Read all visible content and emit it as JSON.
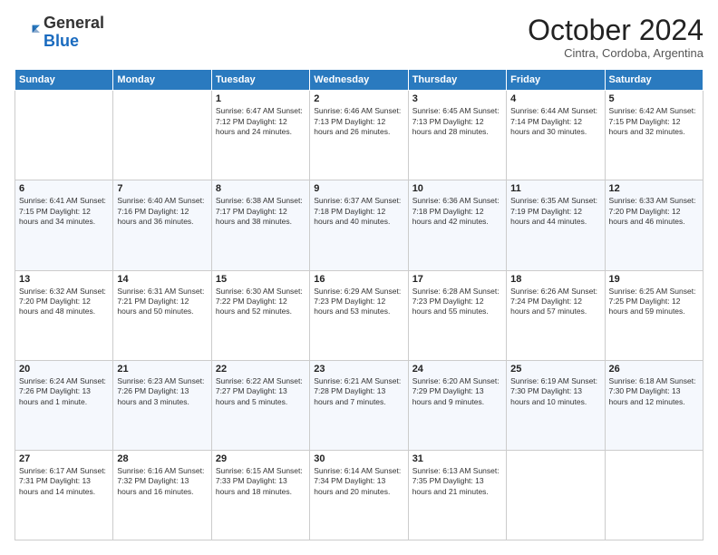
{
  "logo": {
    "general": "General",
    "blue": "Blue"
  },
  "header": {
    "month": "October 2024",
    "location": "Cintra, Cordoba, Argentina"
  },
  "weekdays": [
    "Sunday",
    "Monday",
    "Tuesday",
    "Wednesday",
    "Thursday",
    "Friday",
    "Saturday"
  ],
  "weeks": [
    [
      {
        "day": "",
        "info": ""
      },
      {
        "day": "",
        "info": ""
      },
      {
        "day": "1",
        "info": "Sunrise: 6:47 AM\nSunset: 7:12 PM\nDaylight: 12 hours and 24 minutes."
      },
      {
        "day": "2",
        "info": "Sunrise: 6:46 AM\nSunset: 7:13 PM\nDaylight: 12 hours and 26 minutes."
      },
      {
        "day": "3",
        "info": "Sunrise: 6:45 AM\nSunset: 7:13 PM\nDaylight: 12 hours and 28 minutes."
      },
      {
        "day": "4",
        "info": "Sunrise: 6:44 AM\nSunset: 7:14 PM\nDaylight: 12 hours and 30 minutes."
      },
      {
        "day": "5",
        "info": "Sunrise: 6:42 AM\nSunset: 7:15 PM\nDaylight: 12 hours and 32 minutes."
      }
    ],
    [
      {
        "day": "6",
        "info": "Sunrise: 6:41 AM\nSunset: 7:15 PM\nDaylight: 12 hours and 34 minutes."
      },
      {
        "day": "7",
        "info": "Sunrise: 6:40 AM\nSunset: 7:16 PM\nDaylight: 12 hours and 36 minutes."
      },
      {
        "day": "8",
        "info": "Sunrise: 6:38 AM\nSunset: 7:17 PM\nDaylight: 12 hours and 38 minutes."
      },
      {
        "day": "9",
        "info": "Sunrise: 6:37 AM\nSunset: 7:18 PM\nDaylight: 12 hours and 40 minutes."
      },
      {
        "day": "10",
        "info": "Sunrise: 6:36 AM\nSunset: 7:18 PM\nDaylight: 12 hours and 42 minutes."
      },
      {
        "day": "11",
        "info": "Sunrise: 6:35 AM\nSunset: 7:19 PM\nDaylight: 12 hours and 44 minutes."
      },
      {
        "day": "12",
        "info": "Sunrise: 6:33 AM\nSunset: 7:20 PM\nDaylight: 12 hours and 46 minutes."
      }
    ],
    [
      {
        "day": "13",
        "info": "Sunrise: 6:32 AM\nSunset: 7:20 PM\nDaylight: 12 hours and 48 minutes."
      },
      {
        "day": "14",
        "info": "Sunrise: 6:31 AM\nSunset: 7:21 PM\nDaylight: 12 hours and 50 minutes."
      },
      {
        "day": "15",
        "info": "Sunrise: 6:30 AM\nSunset: 7:22 PM\nDaylight: 12 hours and 52 minutes."
      },
      {
        "day": "16",
        "info": "Sunrise: 6:29 AM\nSunset: 7:23 PM\nDaylight: 12 hours and 53 minutes."
      },
      {
        "day": "17",
        "info": "Sunrise: 6:28 AM\nSunset: 7:23 PM\nDaylight: 12 hours and 55 minutes."
      },
      {
        "day": "18",
        "info": "Sunrise: 6:26 AM\nSunset: 7:24 PM\nDaylight: 12 hours and 57 minutes."
      },
      {
        "day": "19",
        "info": "Sunrise: 6:25 AM\nSunset: 7:25 PM\nDaylight: 12 hours and 59 minutes."
      }
    ],
    [
      {
        "day": "20",
        "info": "Sunrise: 6:24 AM\nSunset: 7:26 PM\nDaylight: 13 hours and 1 minute."
      },
      {
        "day": "21",
        "info": "Sunrise: 6:23 AM\nSunset: 7:26 PM\nDaylight: 13 hours and 3 minutes."
      },
      {
        "day": "22",
        "info": "Sunrise: 6:22 AM\nSunset: 7:27 PM\nDaylight: 13 hours and 5 minutes."
      },
      {
        "day": "23",
        "info": "Sunrise: 6:21 AM\nSunset: 7:28 PM\nDaylight: 13 hours and 7 minutes."
      },
      {
        "day": "24",
        "info": "Sunrise: 6:20 AM\nSunset: 7:29 PM\nDaylight: 13 hours and 9 minutes."
      },
      {
        "day": "25",
        "info": "Sunrise: 6:19 AM\nSunset: 7:30 PM\nDaylight: 13 hours and 10 minutes."
      },
      {
        "day": "26",
        "info": "Sunrise: 6:18 AM\nSunset: 7:30 PM\nDaylight: 13 hours and 12 minutes."
      }
    ],
    [
      {
        "day": "27",
        "info": "Sunrise: 6:17 AM\nSunset: 7:31 PM\nDaylight: 13 hours and 14 minutes."
      },
      {
        "day": "28",
        "info": "Sunrise: 6:16 AM\nSunset: 7:32 PM\nDaylight: 13 hours and 16 minutes."
      },
      {
        "day": "29",
        "info": "Sunrise: 6:15 AM\nSunset: 7:33 PM\nDaylight: 13 hours and 18 minutes."
      },
      {
        "day": "30",
        "info": "Sunrise: 6:14 AM\nSunset: 7:34 PM\nDaylight: 13 hours and 20 minutes."
      },
      {
        "day": "31",
        "info": "Sunrise: 6:13 AM\nSunset: 7:35 PM\nDaylight: 13 hours and 21 minutes."
      },
      {
        "day": "",
        "info": ""
      },
      {
        "day": "",
        "info": ""
      }
    ]
  ]
}
